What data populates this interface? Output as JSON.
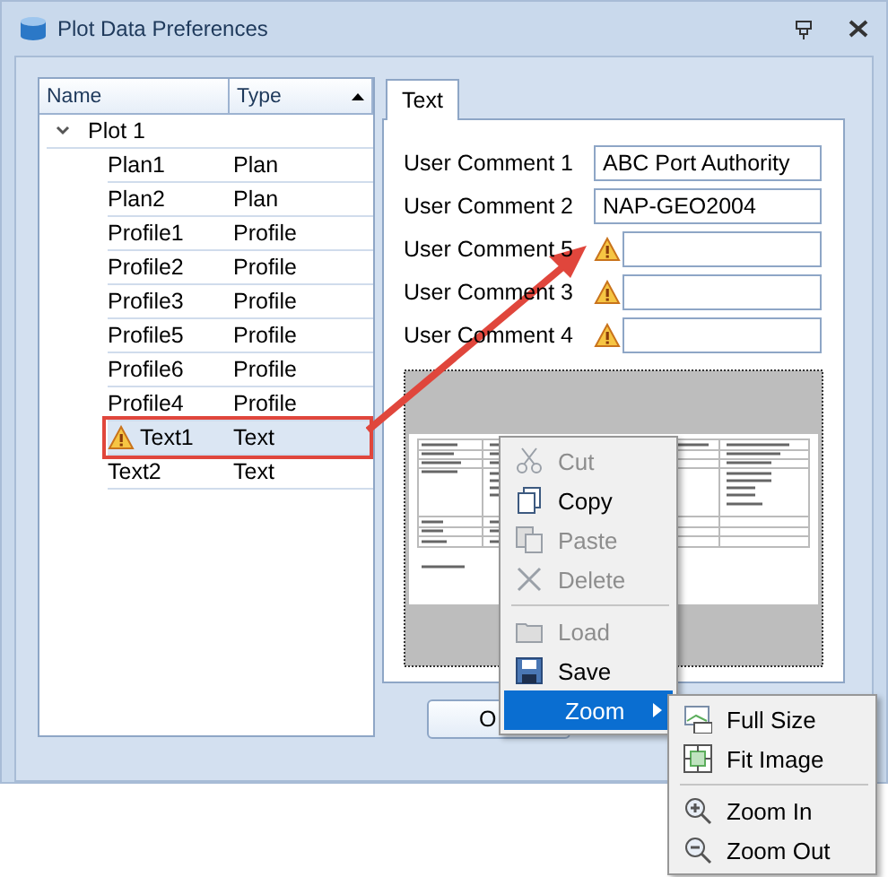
{
  "window": {
    "title": "Plot Data Preferences"
  },
  "tree": {
    "columns": [
      {
        "label": "Name",
        "sorted": false
      },
      {
        "label": "Type",
        "sorted": true
      }
    ],
    "root": {
      "name": "Plot 1",
      "expanded": true,
      "children": [
        {
          "name": "Plan1",
          "type": "Plan",
          "selected": false,
          "warning": false
        },
        {
          "name": "Plan2",
          "type": "Plan",
          "selected": false,
          "warning": false
        },
        {
          "name": "Profile1",
          "type": "Profile",
          "selected": false,
          "warning": false
        },
        {
          "name": "Profile2",
          "type": "Profile",
          "selected": false,
          "warning": false
        },
        {
          "name": "Profile3",
          "type": "Profile",
          "selected": false,
          "warning": false
        },
        {
          "name": "Profile5",
          "type": "Profile",
          "selected": false,
          "warning": false
        },
        {
          "name": "Profile6",
          "type": "Profile",
          "selected": false,
          "warning": false
        },
        {
          "name": "Profile4",
          "type": "Profile",
          "selected": false,
          "warning": false
        },
        {
          "name": "Text1",
          "type": "Text",
          "selected": true,
          "warning": true
        },
        {
          "name": "Text2",
          "type": "Text",
          "selected": false,
          "warning": false
        }
      ]
    }
  },
  "tabs": [
    {
      "label": "Text",
      "selected": true
    }
  ],
  "fields": [
    {
      "label": "User Comment 1",
      "value": "ABC Port Authority",
      "warning": false
    },
    {
      "label": "User Comment 2",
      "value": "NAP-GEO2004",
      "warning": false
    },
    {
      "label": "User Comment 5",
      "warning": true
    },
    {
      "label": "User Comment 3",
      "warning": true
    },
    {
      "label": "User Comment 4",
      "warning": true
    }
  ],
  "buttons": [
    "O"
  ],
  "context_menu": [
    {
      "kind": "item",
      "label": "Cut",
      "disabled": true,
      "selected": false
    },
    {
      "kind": "item",
      "label": "Copy",
      "disabled": false,
      "selected": false
    },
    {
      "kind": "item",
      "label": "Paste",
      "disabled": true,
      "selected": false
    },
    {
      "kind": "item",
      "label": "Delete",
      "disabled": true,
      "selected": false
    },
    {
      "kind": "separator"
    },
    {
      "kind": "item",
      "label": "Load",
      "disabled": true,
      "selected": false
    },
    {
      "kind": "item",
      "label": "Save",
      "disabled": false,
      "selected": false
    },
    {
      "kind": "submenu",
      "label": "Zoom",
      "disabled": false,
      "selected": true
    }
  ],
  "submenu": [
    {
      "kind": "item",
      "label": "Full Size"
    },
    {
      "kind": "item",
      "label": "Fit Image"
    },
    {
      "kind": "separator"
    },
    {
      "kind": "item",
      "label": "Zoom In"
    },
    {
      "kind": "item",
      "label": "Zoom Out"
    }
  ]
}
